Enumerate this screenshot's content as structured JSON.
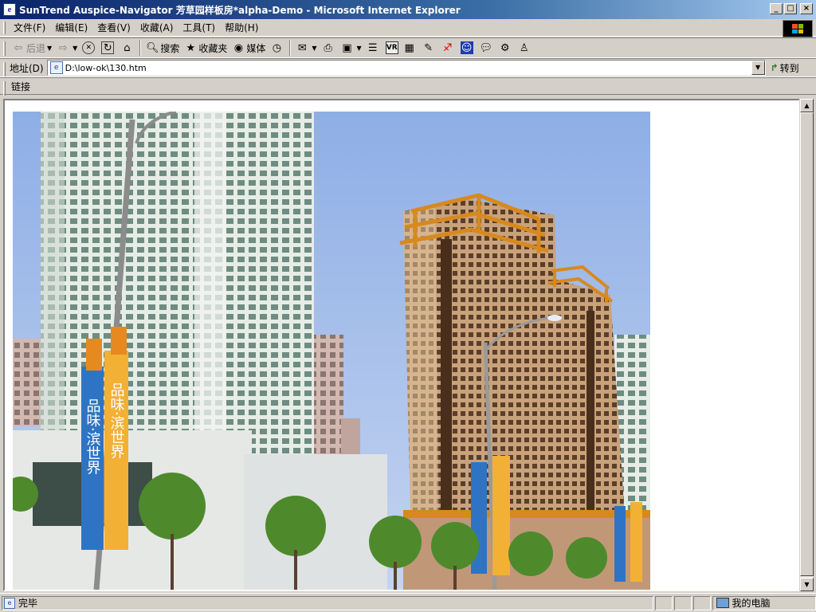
{
  "window": {
    "title": "SunTrend Auspice-Navigator 芳草园样板房*alpha-Demo - Microsoft Internet Explorer",
    "app_icon": "ie-icon",
    "controls": {
      "minimize": "_",
      "maximize": "□",
      "close": "×"
    }
  },
  "menubar": {
    "items": [
      {
        "label": "文件(F)"
      },
      {
        "label": "编辑(E)"
      },
      {
        "label": "查看(V)"
      },
      {
        "label": "收藏(A)"
      },
      {
        "label": "工具(T)"
      },
      {
        "label": "帮助(H)"
      }
    ]
  },
  "toolbar": {
    "back_label": "后退",
    "search_label": "搜索",
    "favorites_label": "收藏夹",
    "media_label": "媒体",
    "icons": [
      "back-arrow-icon",
      "forward-arrow-icon",
      "stop-icon",
      "refresh-icon",
      "home-icon",
      "search-icon",
      "favorites-icon",
      "media-icon",
      "history-icon",
      "mail-icon",
      "print-icon",
      "edit-icon",
      "discuss-icon",
      "vr-icon",
      "grid-icon",
      "tool-icon",
      "pencil-icon",
      "qq-icon",
      "chat-icon",
      "settings-icon",
      "messenger-icon"
    ],
    "vr_text": "VR"
  },
  "addressbar": {
    "label": "地址(D)",
    "value": "D:\\low-ok\\130.htm",
    "go_label": "转到"
  },
  "linksbar": {
    "label": "链接"
  },
  "content": {
    "image_subject": "architectural-rendering-residential-towers",
    "banner_text": "品味·滨世界"
  },
  "statusbar": {
    "text": "完毕",
    "zone": "我的电脑"
  },
  "colors": {
    "titlebar_start": "#0a246a",
    "titlebar_end": "#a6caf0",
    "chrome": "#d4d0c8",
    "sky": "#9fb8e8"
  }
}
